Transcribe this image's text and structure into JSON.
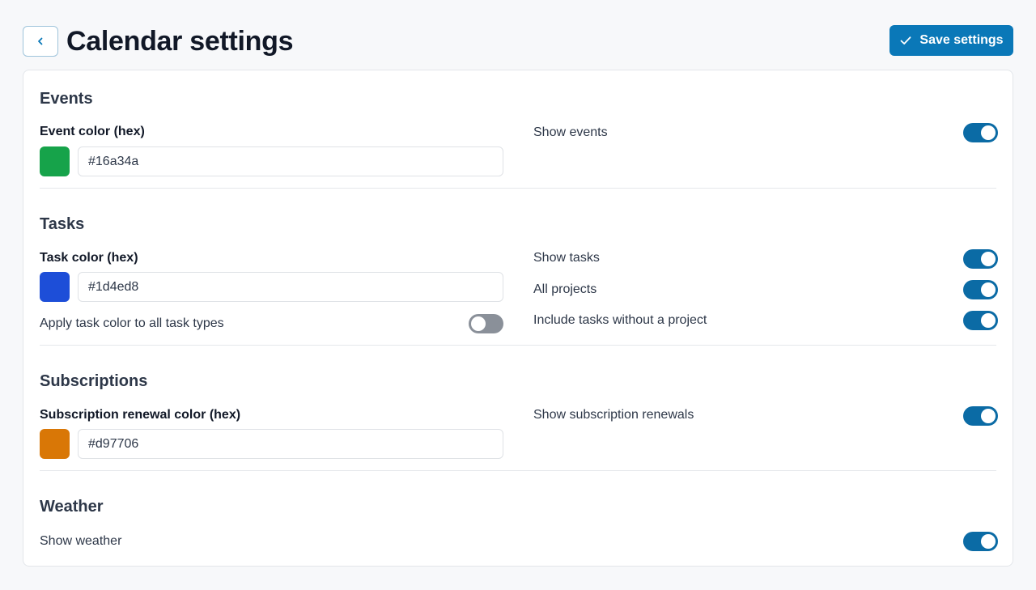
{
  "header": {
    "title": "Calendar settings",
    "save_label": "Save settings"
  },
  "events": {
    "title": "Events",
    "color_label": "Event color (hex)",
    "color_value": "#16a34a",
    "show_label": "Show events",
    "show_on": true
  },
  "tasks": {
    "title": "Tasks",
    "color_label": "Task color (hex)",
    "color_value": "#1d4ed8",
    "apply_all_label": "Apply task color to all task types",
    "apply_all_on": false,
    "show_label": "Show tasks",
    "show_on": true,
    "all_projects_label": "All projects",
    "all_projects_on": true,
    "no_project_label": "Include tasks without a project",
    "no_project_on": true
  },
  "subscriptions": {
    "title": "Subscriptions",
    "color_label": "Subscription renewal color (hex)",
    "color_value": "#d97706",
    "show_label": "Show subscription renewals",
    "show_on": true
  },
  "weather": {
    "title": "Weather",
    "show_label": "Show weather",
    "show_on": true
  },
  "colors": {
    "primary": "#0a78b8",
    "toggle_on": "#0b6ba5",
    "toggle_off": "#8a9099"
  }
}
